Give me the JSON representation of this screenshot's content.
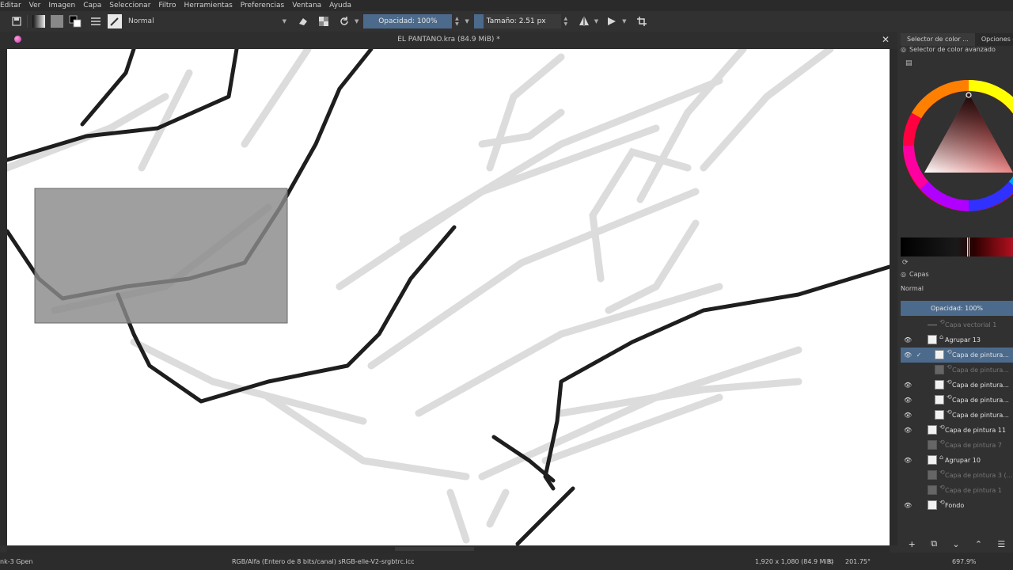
{
  "menu": [
    "Editar",
    "Ver",
    "Imagen",
    "Capa",
    "Seleccionar",
    "Filtro",
    "Herramientas",
    "Preferencias",
    "Ventana",
    "Ayuda"
  ],
  "toolbar": {
    "blend_mode": "Normal",
    "opacity_label": "Opacidad: 100%",
    "size_label": "Tamaño: 2.51 px",
    "icons": [
      "save-icon",
      "gradient-icon",
      "pattern-icon",
      "color-swap-icon",
      "brush-presets-icon",
      "brush-icon",
      "eraser-icon",
      "alpha-lock-icon",
      "reload-icon",
      "mirror-horizontal-icon",
      "mirror-vertical-icon",
      "wrap-icon"
    ]
  },
  "document": {
    "title": "EL PANTANO.kra (84.9 MiB) *"
  },
  "dock": {
    "tabs": [
      "Selector de color ...",
      "Opciones de"
    ],
    "advanced_selector_label": "Selector de color avanzado",
    "layers_title": "Capas",
    "blend_mode": "Normal",
    "opacity_label": "Opacidad:  100%",
    "layers": [
      {
        "name": "Capa vectorial 1",
        "visible": false,
        "indent": 0,
        "kind": "vector",
        "selected": false,
        "checked": false
      },
      {
        "name": "Agrupar 13",
        "visible": true,
        "indent": 0,
        "kind": "group",
        "selected": false,
        "checked": false
      },
      {
        "name": "Capa de pintura...",
        "visible": true,
        "indent": 1,
        "kind": "paint",
        "selected": true,
        "checked": true
      },
      {
        "name": "Capa de pintura...",
        "visible": false,
        "indent": 1,
        "kind": "paint-dim",
        "selected": false,
        "checked": false
      },
      {
        "name": "Capa de pintura...",
        "visible": true,
        "indent": 1,
        "kind": "paint",
        "selected": false,
        "checked": false
      },
      {
        "name": "Capa de pintura...",
        "visible": true,
        "indent": 1,
        "kind": "paint",
        "selected": false,
        "checked": false
      },
      {
        "name": "Capa de pintura...",
        "visible": true,
        "indent": 1,
        "kind": "paint",
        "selected": false,
        "checked": false
      },
      {
        "name": "Capa de pintura 11",
        "visible": true,
        "indent": 0,
        "kind": "paint",
        "selected": false,
        "checked": false
      },
      {
        "name": "Capa de pintura 7",
        "visible": false,
        "indent": 0,
        "kind": "paint-dim",
        "selected": false,
        "checked": false
      },
      {
        "name": "Agrupar 10",
        "visible": true,
        "indent": 0,
        "kind": "group",
        "selected": false,
        "checked": false
      },
      {
        "name": "Capa de pintura 3 (...",
        "visible": false,
        "indent": 0,
        "kind": "paint-dim",
        "selected": false,
        "checked": false
      },
      {
        "name": "Capa de pintura 1",
        "visible": false,
        "indent": 0,
        "kind": "paint-dim",
        "selected": false,
        "checked": false
      },
      {
        "name": "Fondo",
        "visible": true,
        "indent": 0,
        "kind": "paint",
        "selected": false,
        "checked": false
      }
    ],
    "layer_tools": [
      "add-layer-icon",
      "duplicate-layer-icon",
      "move-down-icon",
      "move-up-icon",
      "layer-properties-icon"
    ]
  },
  "status": {
    "brush": "nk-3 Gpen",
    "colorspace": "RGB/Alfa (Entero de 8 bits/canal)  sRGB-elle-V2-srgbtrc.icc",
    "dimensions": "1,920 x 1,080 (84.9 MiB)",
    "rotation": "201.75°",
    "zoom": "697.9%"
  },
  "colors": {
    "accent": "#4c6a8b",
    "background": "#313131",
    "canvas": "#ffffff"
  }
}
